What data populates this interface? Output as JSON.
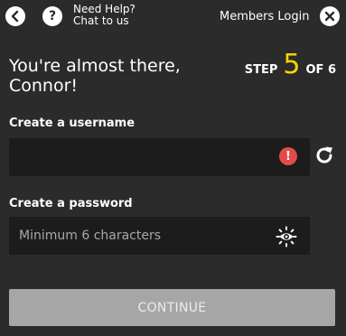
{
  "header": {
    "help_line1": "Need Help?",
    "help_line2": "Chat to us",
    "members_login": "Members Login"
  },
  "heading": {
    "line1": "You're almost there,",
    "line2": "Connor!"
  },
  "step": {
    "prefix": "STEP",
    "current": "5",
    "suffix": "OF 6"
  },
  "username": {
    "label": "Create a username",
    "value": "",
    "placeholder": ""
  },
  "password": {
    "label": "Create a password",
    "value": "",
    "placeholder": "Minimum 6 characters"
  },
  "continue_label": "CONTINUE",
  "icons": {
    "back": "back-arrow-icon",
    "help": "question-icon",
    "close": "close-icon",
    "error": "error-icon",
    "refresh": "refresh-icon",
    "show_password": "eye-icon"
  },
  "colors": {
    "background": "#2b2b2b",
    "field": "#1c1c1c",
    "accent": "#ffd400",
    "error": "#e24b4b",
    "button_disabled": "#a6a6a6"
  }
}
